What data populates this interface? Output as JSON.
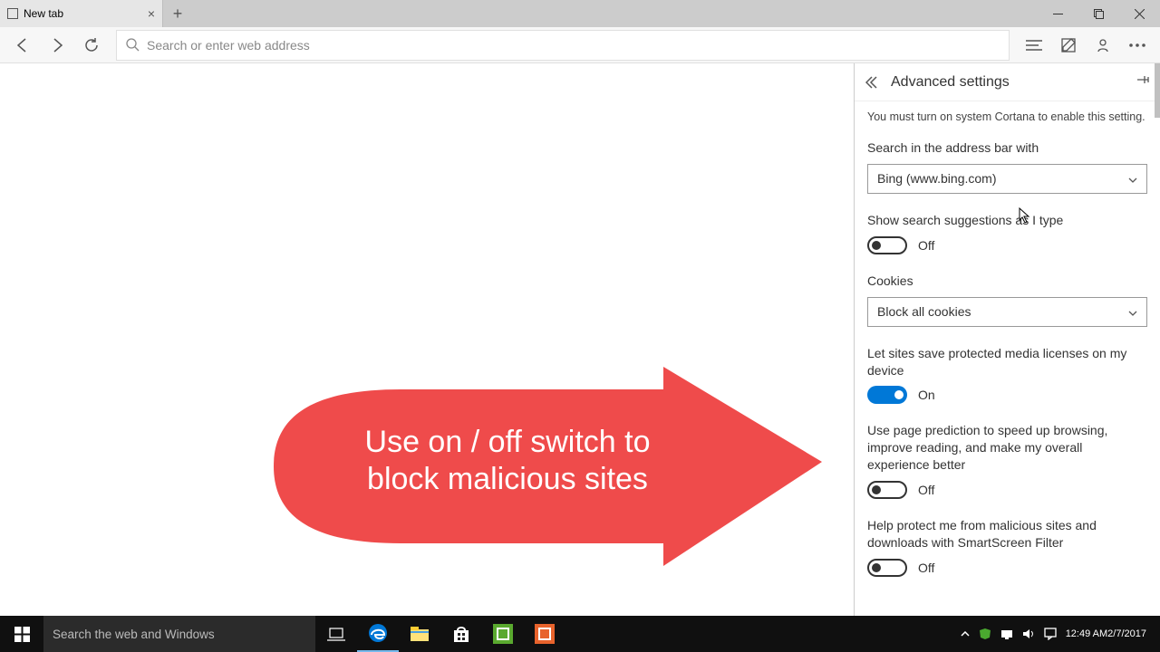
{
  "tab": {
    "title": "New tab"
  },
  "addressbar": {
    "placeholder": "Search or enter web address"
  },
  "panel": {
    "title": "Advanced settings",
    "note": "You must turn on system Cortana to enable this setting.",
    "search_engine": {
      "label": "Search in the address bar with",
      "value": "Bing (www.bing.com)"
    },
    "suggestions": {
      "label": "Show search suggestions as I type",
      "state": "Off"
    },
    "cookies": {
      "label": "Cookies",
      "value": "Block all cookies"
    },
    "media_licenses": {
      "label": "Let sites save protected media licenses on my device",
      "state": "On"
    },
    "page_prediction": {
      "label": "Use page prediction to speed up browsing, improve reading, and make my overall experience better",
      "state": "Off"
    },
    "smartscreen": {
      "label": "Help protect me from malicious sites and downloads with SmartScreen Filter",
      "state": "Off"
    }
  },
  "annotation": {
    "line1": "Use on / off switch to",
    "line2": "block malicious sites"
  },
  "taskbar": {
    "search_placeholder": "Search the web and Windows",
    "time": "12:49 AM",
    "date": "2/7/2017"
  }
}
